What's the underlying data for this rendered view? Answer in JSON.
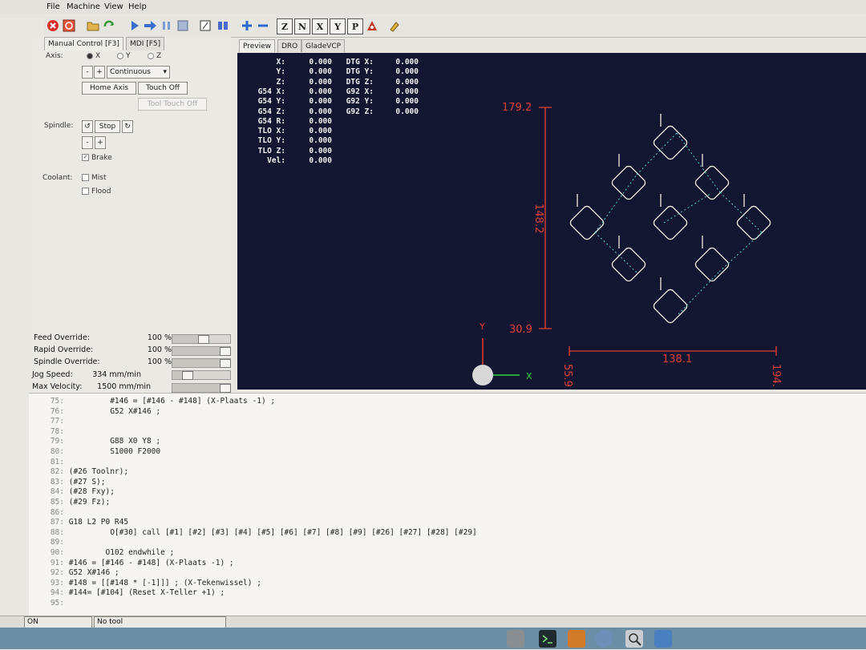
{
  "menu": [
    "File",
    "Machine",
    "View",
    "Help"
  ],
  "toolbar": {
    "axis_buttons": [
      "Z",
      "N",
      "X",
      "Y",
      "P"
    ]
  },
  "tabs": {
    "manual": "Manual Control [F3]",
    "mdi": "MDI [F5]"
  },
  "axis": {
    "label": "Axis:",
    "options": [
      "X",
      "Y",
      "Z"
    ],
    "selected": "X",
    "minus": "-",
    "plus": "+",
    "mode": "Continuous"
  },
  "buttons": {
    "home_axis": "Home Axis",
    "touch_off": "Touch Off",
    "tool_touch_off": "Tool Touch Off"
  },
  "spindle": {
    "label": "Spindle:",
    "stop": "Stop",
    "minus": "-",
    "plus": "+",
    "brake": "Brake"
  },
  "coolant": {
    "label": "Coolant:",
    "mist": "Mist",
    "flood": "Flood"
  },
  "overrides": [
    {
      "label": "Feed Override:",
      "value": "100 %",
      "fraction": 0.55
    },
    {
      "label": "Rapid Override:",
      "value": "100 %",
      "fraction": 1.0
    },
    {
      "label": "Spindle Override:",
      "value": "100 %",
      "fraction": 1.0
    },
    {
      "label": "Jog Speed:",
      "value": "334 mm/min",
      "fraction": 0.2
    },
    {
      "label": "Max Velocity:",
      "value": "1500 mm/min",
      "fraction": 1.0
    }
  ],
  "preview_tabs": [
    "Preview",
    "DRO",
    "GladeVCP"
  ],
  "dro_left": [
    {
      "label": "X:",
      "value": "0.000"
    },
    {
      "label": "Y:",
      "value": "0.000"
    },
    {
      "label": "Z:",
      "value": "0.000"
    },
    {
      "label": "G54 X:",
      "value": "0.000"
    },
    {
      "label": "G54 Y:",
      "value": "0.000"
    },
    {
      "label": "G54 Z:",
      "value": "0.000"
    },
    {
      "label": "G54 R:",
      "value": "0.000"
    },
    {
      "label": "TLO X:",
      "value": "0.000"
    },
    {
      "label": "TLO Y:",
      "value": "0.000"
    },
    {
      "label": "TLO Z:",
      "value": "0.000"
    },
    {
      "label": "Vel:",
      "value": "0.000"
    }
  ],
  "dro_right": [
    {
      "label": "DTG X:",
      "value": "0.000"
    },
    {
      "label": "DTG Y:",
      "value": "0.000"
    },
    {
      "label": "DTG Z:",
      "value": "0.000"
    },
    {
      "label": "G92 X:",
      "value": "0.000"
    },
    {
      "label": "G92 Y:",
      "value": "0.000"
    },
    {
      "label": "G92 Z:",
      "value": "0.000"
    }
  ],
  "preview": {
    "dim_top": "179.2",
    "dim_bottom": "30.9",
    "dim_height": "148.2",
    "dim_width": "138.1",
    "dim_x_left": "55.9",
    "dim_x_right": "194.",
    "axis_y": "Y",
    "axis_x": "X",
    "colors": {
      "background": "#121630",
      "dimension": "#e0403a",
      "path": "#f1ece0",
      "toolpath": "#4fd0c6",
      "axis_y": "#e83a2e",
      "axis_x": "#2fd43a"
    }
  },
  "code": [
    {
      "n": "75:",
      "t": "          #146 = [#146 - #148] (X-Plaats -1) ;"
    },
    {
      "n": "76:",
      "t": "          G52 X#146 ;"
    },
    {
      "n": "77:",
      "t": ""
    },
    {
      "n": "78:",
      "t": ""
    },
    {
      "n": "79:",
      "t": "          G88 X0 Y8 ;"
    },
    {
      "n": "80:",
      "t": "          S1000 F2000"
    },
    {
      "n": "81:",
      "t": ""
    },
    {
      "n": "82:",
      "t": " (#26 Toolnr);"
    },
    {
      "n": "83:",
      "t": " (#27 S);"
    },
    {
      "n": "84:",
      "t": " (#28 Fxy);"
    },
    {
      "n": "85:",
      "t": " (#29 Fz);"
    },
    {
      "n": "86:",
      "t": ""
    },
    {
      "n": "87:",
      "t": " G18 L2 P0 R45"
    },
    {
      "n": "88:",
      "t": "          O[#30] call [#1] [#2] [#3] [#4] [#5] [#6] [#7] [#8] [#9] [#26] [#27] [#28] [#29]"
    },
    {
      "n": "89:",
      "t": ""
    },
    {
      "n": "90:",
      "t": "         O102 endwhile ;"
    },
    {
      "n": "91:",
      "t": " #146 = [#146 - #148] (X-Plaats -1) ;"
    },
    {
      "n": "92:",
      "t": " G52 X#146 ;"
    },
    {
      "n": "93:",
      "t": " #148 = [[#148 * [-1]]] ; (X-Tekenwissel) ;"
    },
    {
      "n": "94:",
      "t": " #144= [#104] (Reset X-Teller +1) ;"
    },
    {
      "n": "95:",
      "t": ""
    }
  ],
  "status": {
    "state": "ON",
    "tool": "No tool"
  }
}
